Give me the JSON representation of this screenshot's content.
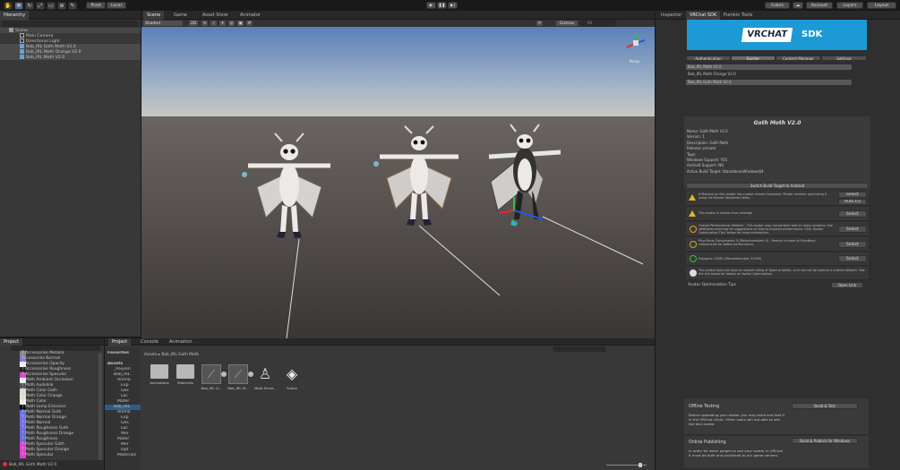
{
  "toolbar": {
    "pivot": "Pivot",
    "local": "Local",
    "collab": "Colors",
    "account": "Account",
    "layers": "Layers",
    "layout": "Layout"
  },
  "hierarchy": {
    "tab": "Hierarchy",
    "items": [
      "Scene",
      "Main Camera",
      "Directional Light",
      "Bob_IRL Goth Moth V2.0",
      "Bob_IRL Moth Orange V2.0",
      "Bob_IRL Moth V2.0"
    ]
  },
  "scene_tabs": [
    "Scene",
    "Game",
    "Asset Store",
    "Animator"
  ],
  "scene_toolbar": {
    "shading": "Shaded",
    "mode": "2D",
    "gizmos": "Gizmos",
    "search": "All"
  },
  "gizmo": {
    "persp": "Persp"
  },
  "inspector": {
    "tabs": [
      "Inspector",
      "VRChat SDK",
      "Pumkin Tools"
    ],
    "logo": "VRCHAT",
    "logo_sdk": "SDK",
    "sdk_tabs": [
      "Authentication",
      "Builder",
      "Content Manager",
      "Settings"
    ],
    "avatars": [
      "Bob_IRL Moth V2.0",
      "Bob_IRL Moth Orange V2.0",
      "Bob_IRL Goth Moth V2.0"
    ],
    "avatar_title": "Goth Moth V2.0",
    "details": [
      "Name: Goth Moth V2.0",
      "Version: 1",
      "Description: Goth Moth",
      "Release: private",
      "Tags:",
      "Windows Support: YES",
      "Android Support: NO",
      "Active Build Target: StandaloneWindows64"
    ],
    "switch_target": "Switch Build Target to Android",
    "messages": [
      "A Material on this avatar has custom shader keywords. Please consider optimizing it using the Shader Keywords Utility.",
      "This avatar is shorter than average",
      "Overall Performance: Medium - This avatar may not perform well on many systems. See additional warnings for suggestions on how to improve performance. Click 'Avatar Optimization Tips' below for more information.",
      "Phys Bone Components: 8 (Recommended: 4) - Reduce number of PhysBone components for better performance.",
      "Polygons: 43461 (Recommended: 32000)",
      "This avatar does not have an overall rating of Good or better, so it can not be used as a custom fallback. See the link below for details on Avatar Optimization."
    ],
    "select": "Select",
    "auto_fix": "Auto Fix",
    "tips_label": "Avatar Optimization Tips",
    "open_link": "Open Link",
    "offline_title": "Offline Testing",
    "offline_text": "Before uploading your avatar you may build and test it in the VRChat client. Other users will not able to see the test avatar.",
    "build_test": "Build & Test",
    "online_title": "Online Publishing",
    "online_text": "In order for other people to see your avatar in VRChat it must be built and published to our game servers.",
    "build_publish": "Build & Publish for Windows"
  },
  "material_panel": {
    "tab": "Project",
    "props": [
      "T Accessories Metallic",
      "Accessories Normal",
      "T Accessories Opacity",
      "T Accessories Roughness",
      "T Accessories Specular",
      "T Moth Ambient Occlusion",
      "T Moth Audolink",
      "T Moth Color Goth",
      "T Moth Color Orange",
      "T Moth Color",
      "T Moth Lamp Emission",
      "T Moth Normal Goth",
      "T Moth Normal Orange",
      "T Moth Normal",
      "T Moth Roughness Goth",
      "T Moth Roughness Orange",
      "T Moth Roughness",
      "T Moth Specular Goth",
      "T Moth Specular Orange",
      "T Moth Specular"
    ],
    "footer": "Bob_IRL Goth Moth V2.0"
  },
  "project": {
    "tabs": [
      "Project",
      "Console",
      "Animation"
    ],
    "breadcrumb": [
      "Assets",
      "Bob_IRL Goth Moth"
    ],
    "tree": [
      "Favorites",
      "Assets",
      "_Poiyom",
      "Bob_IRL",
      "Anima",
      "Exp",
      "Ges",
      "Loc",
      "Mater",
      "Bob_IRL",
      "Anima",
      "Exp",
      "Ges",
      "Loc",
      "Mer",
      "Mater",
      "Mer",
      "Opt",
      "Materials"
    ],
    "assets": [
      "Animations",
      "Materials",
      "Bob_IRL G...",
      "Bob_IRL M...",
      "Moth Scree...",
      "Scene"
    ]
  },
  "colors": {
    "vrchat_blue": "#1c9ad6",
    "sky_top": "#5a80b8",
    "ground": "#4d4745",
    "selection": "#2c5d87",
    "magenta": "#e040d0",
    "lilac": "#7070e8"
  }
}
